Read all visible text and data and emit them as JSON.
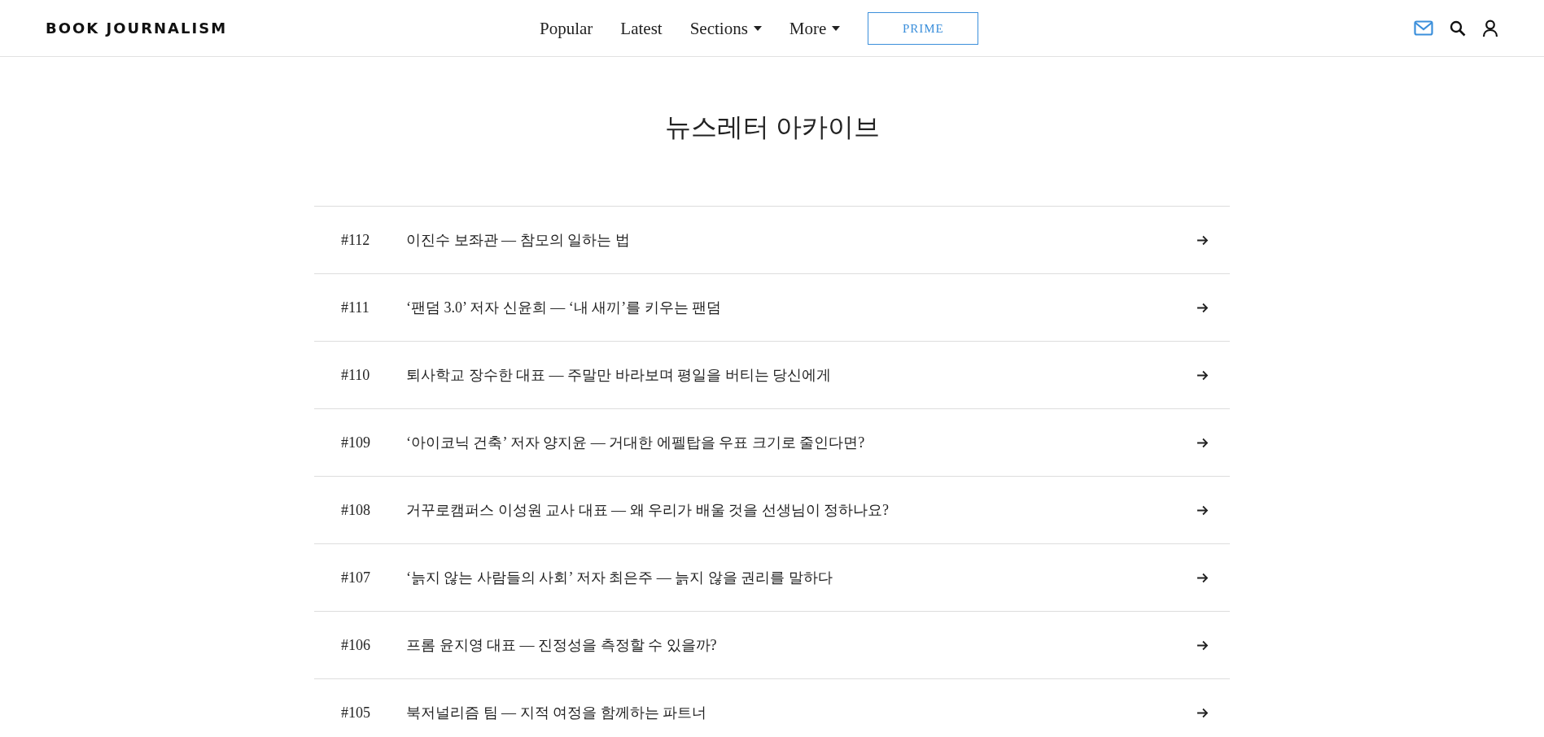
{
  "header": {
    "logo": "BOOK JOURNALISM",
    "nav": [
      {
        "label": "Popular",
        "kind": "link"
      },
      {
        "label": "Latest",
        "kind": "link"
      },
      {
        "label": "Sections",
        "kind": "dropdown"
      },
      {
        "label": "More",
        "kind": "dropdown"
      }
    ],
    "prime_button": "PRIME"
  },
  "page_title": "뉴스레터 아카이브",
  "newsletters": [
    {
      "number": "#112",
      "title": "이진수 보좌관 — 참모의 일하는 법"
    },
    {
      "number": "#111",
      "title": "‘팬덤 3.0’ 저자 신윤희 — ‘내 새끼’를 키우는 팬덤"
    },
    {
      "number": "#110",
      "title": "퇴사학교 장수한 대표 — 주말만 바라보며 평일을 버티는 당신에게"
    },
    {
      "number": "#109",
      "title": "‘아이코닉 건축’ 저자 양지윤 — 거대한 에펠탑을 우표 크기로 줄인다면?"
    },
    {
      "number": "#108",
      "title": "거꾸로캠퍼스 이성원 교사 대표 — 왜 우리가 배울 것을 선생님이 정하나요?"
    },
    {
      "number": "#107",
      "title": "‘늙지 않는 사람들의 사회’ 저자 최은주 — 늙지 않을 권리를 말하다"
    },
    {
      "number": "#106",
      "title": "프롬 윤지영 대표 — 진정성을 측정할 수 있을까?"
    },
    {
      "number": "#105",
      "title": "북저널리즘 팀 — 지적 여정을 함께하는 파트너"
    }
  ]
}
